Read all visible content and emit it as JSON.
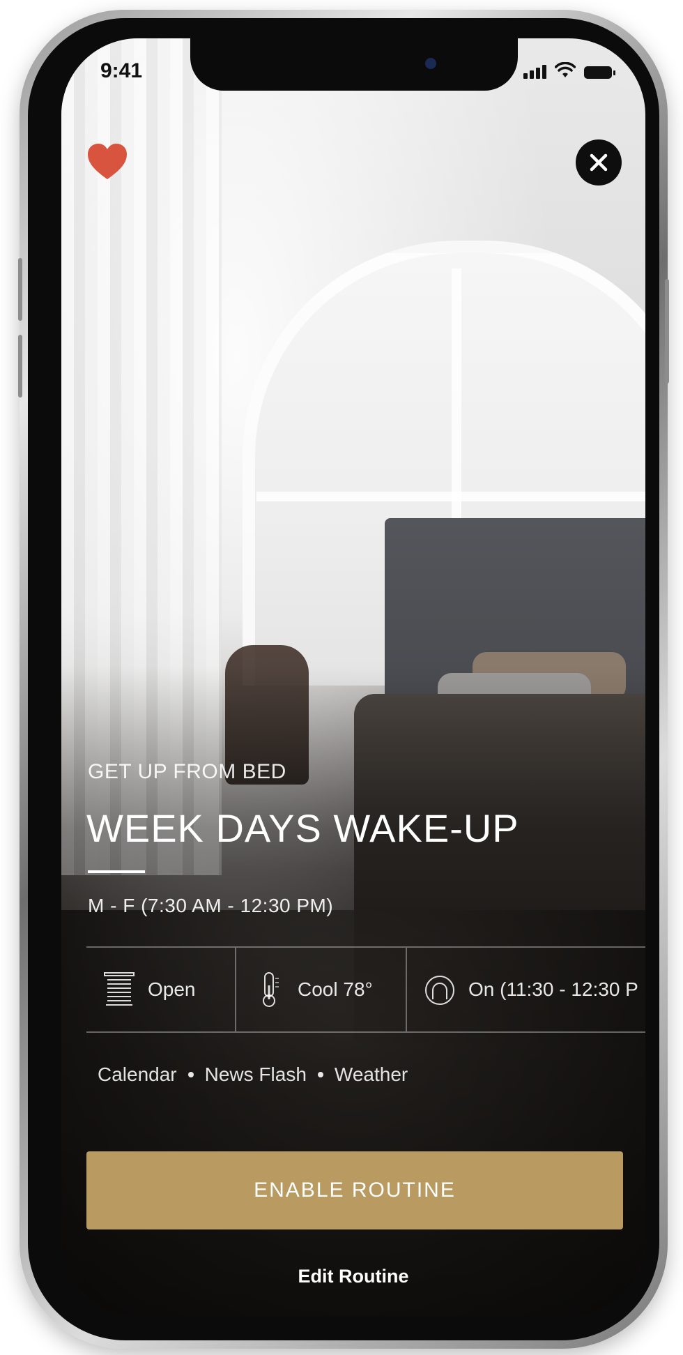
{
  "status_bar": {
    "time": "9:41"
  },
  "header": {
    "favorite_icon": "heart-icon",
    "close_icon": "close-icon"
  },
  "routine": {
    "subtitle": "GET UP FROM BED",
    "title": "WEEK DAYS WAKE-UP",
    "schedule": "M - F (7:30 AM - 12:30 PM)"
  },
  "devices": [
    {
      "icon": "blinds-icon",
      "label": "Open"
    },
    {
      "icon": "thermometer-icon",
      "label": "Cool 78°"
    },
    {
      "icon": "lamp-icon",
      "label": "On (11:30 - 12:30 P"
    }
  ],
  "features": [
    "Calendar",
    "News Flash",
    "Weather"
  ],
  "actions": {
    "enable_label": "ENABLE ROUTINE",
    "edit_label": "Edit Routine"
  },
  "colors": {
    "accent": "#b99b61",
    "heart": "#d9543f"
  }
}
